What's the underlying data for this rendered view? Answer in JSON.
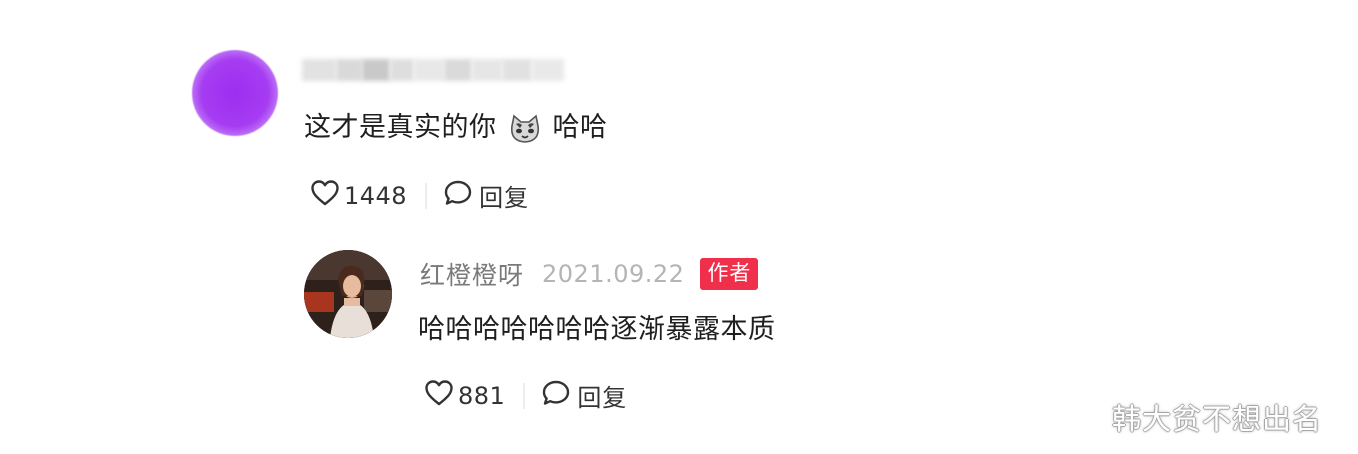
{
  "comment": {
    "text_before": "这才是真实的你",
    "emoji": "cat-face-emoji",
    "text_after": "哈哈",
    "like_count": "1448",
    "reply_label": "回复"
  },
  "reply": {
    "author_name": "红橙橙呀",
    "date": "2021.09.22",
    "author_badge": "作者",
    "text": "哈哈哈哈哈哈哈逐渐暴露本质",
    "like_count": "881",
    "reply_label": "回复"
  },
  "watermark": "韩大贫不想出名",
  "colors": {
    "author_badge_bg": "#f0304a",
    "avatar_purple": "#a63cf2"
  },
  "icons": [
    "heart-icon",
    "comment-bubble-icon",
    "cat-face-emoji"
  ]
}
